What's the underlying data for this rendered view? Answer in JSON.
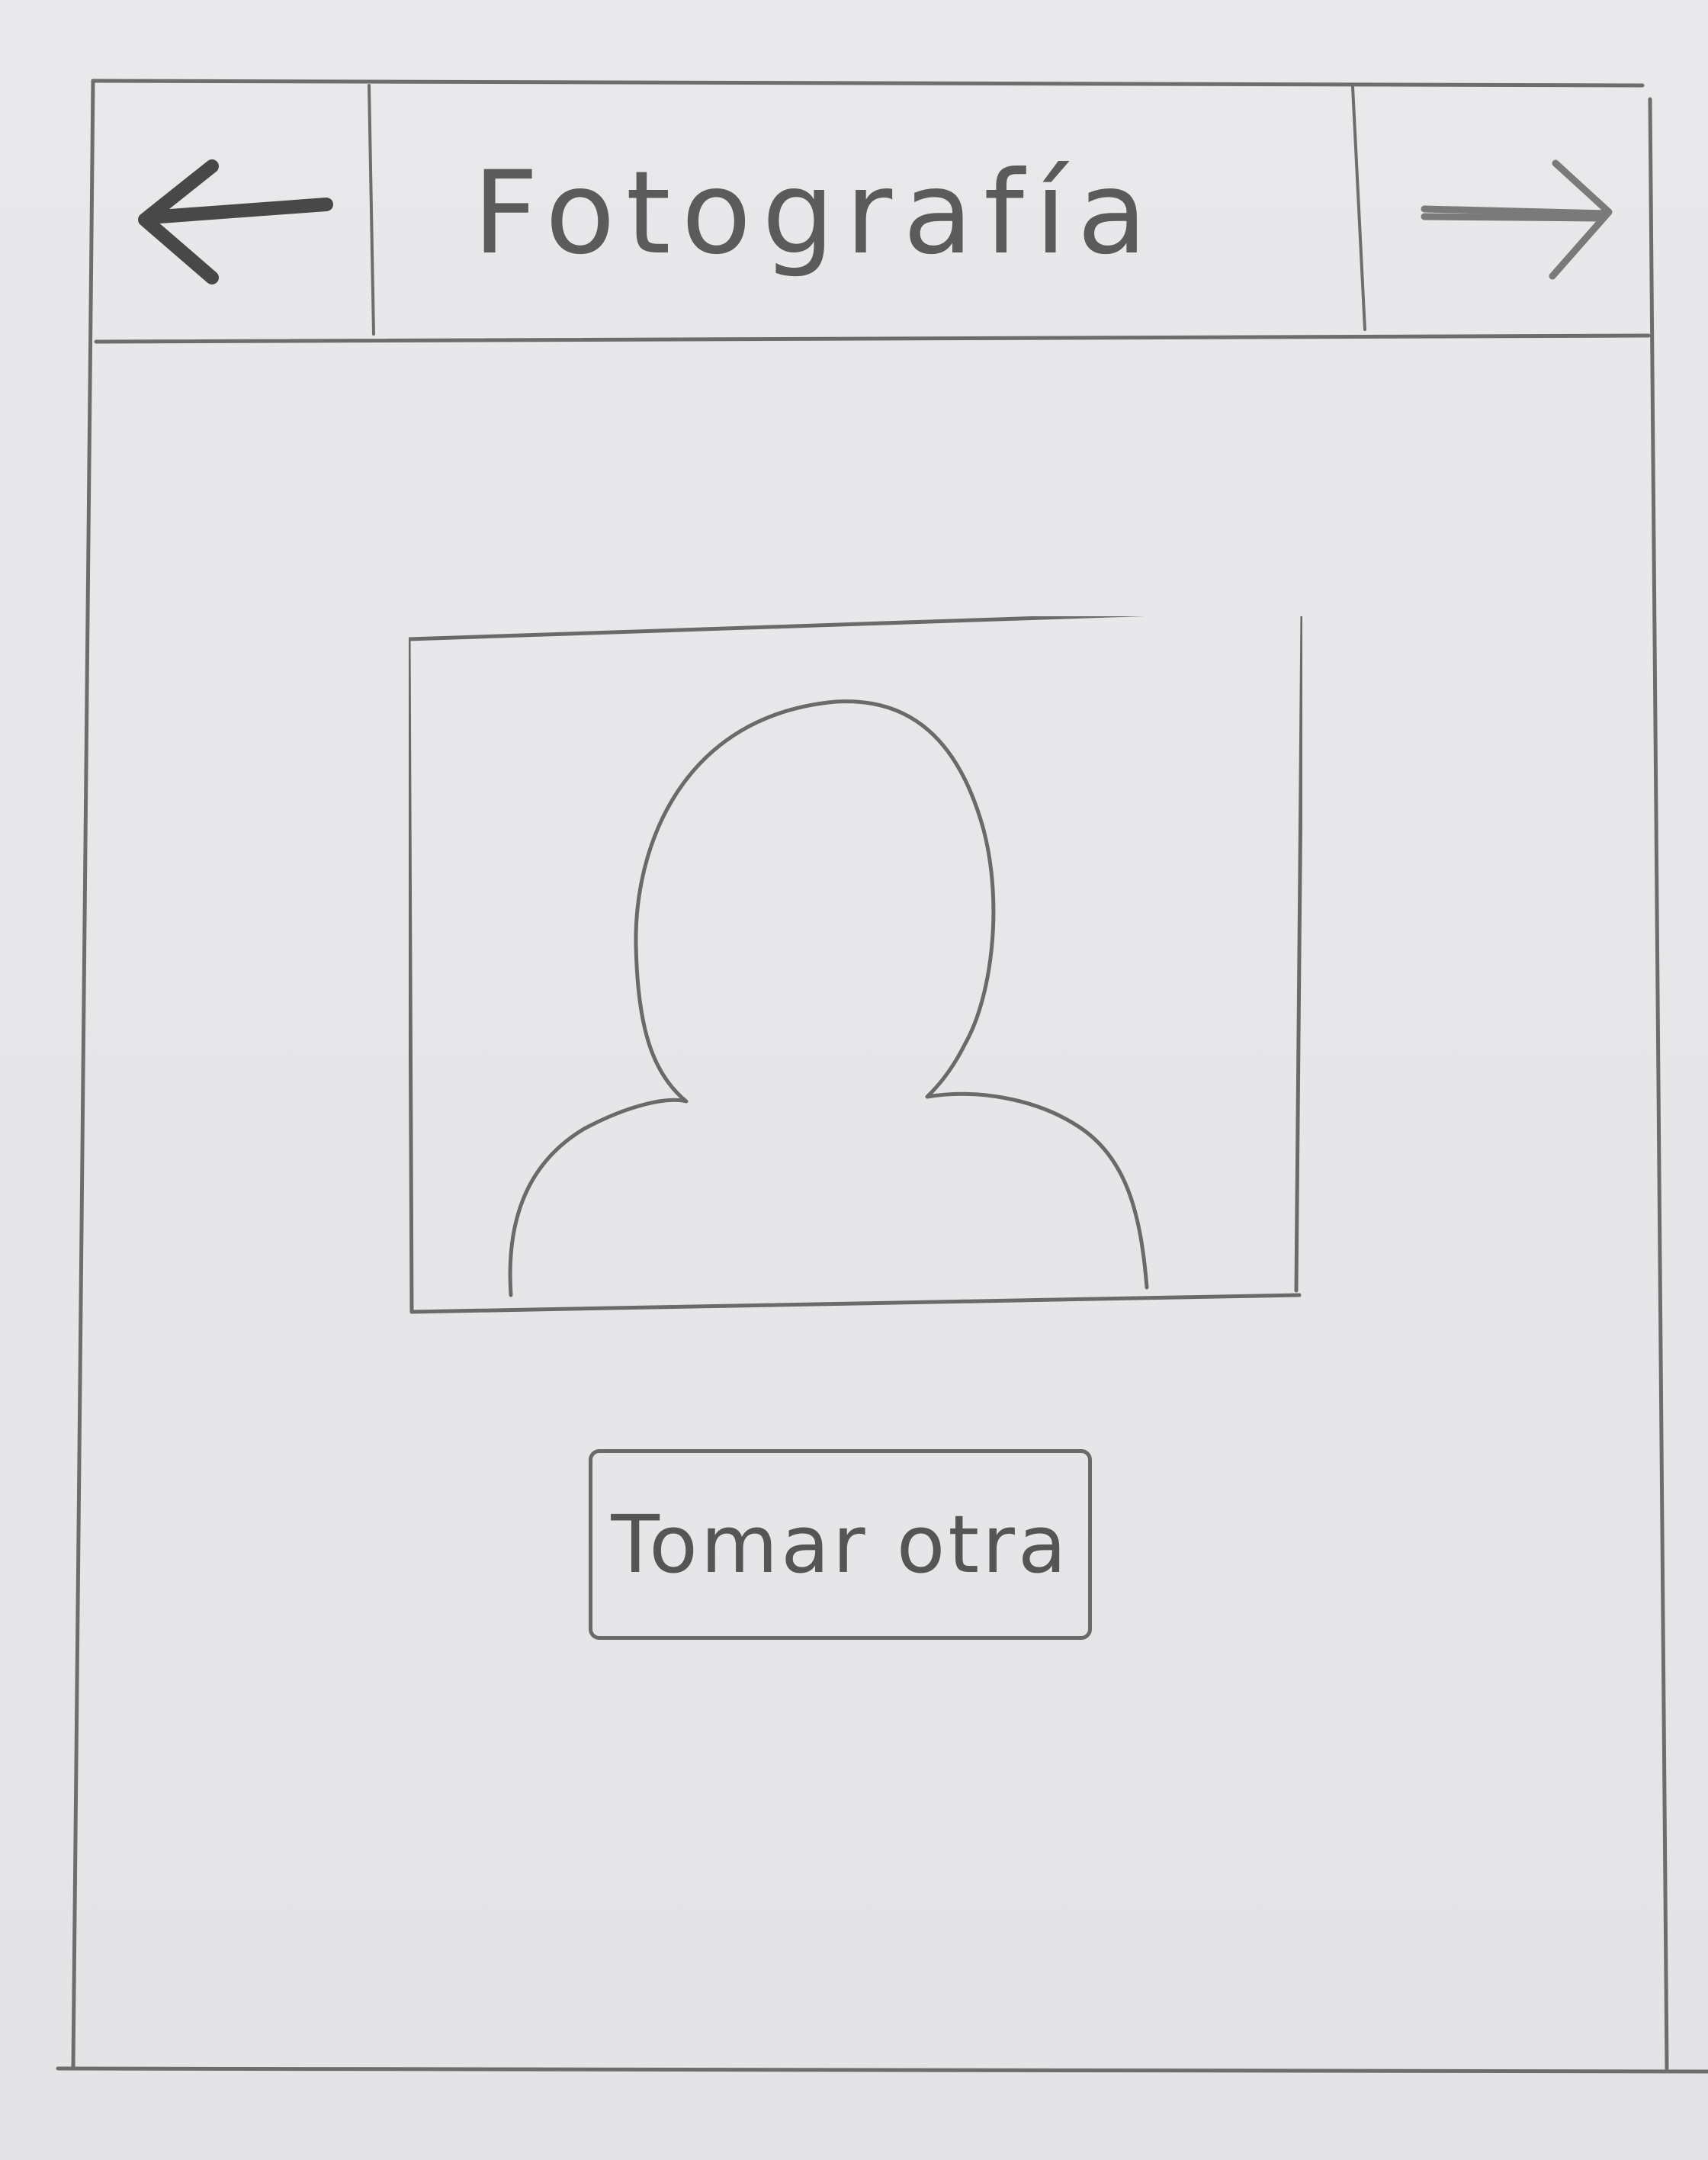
{
  "header": {
    "title": "Fotografía",
    "back_icon": "arrow-left-icon",
    "forward_icon": "arrow-right-icon"
  },
  "photo": {
    "icon": "person-silhouette-icon"
  },
  "actions": {
    "retake_label": "Tomar otra"
  }
}
